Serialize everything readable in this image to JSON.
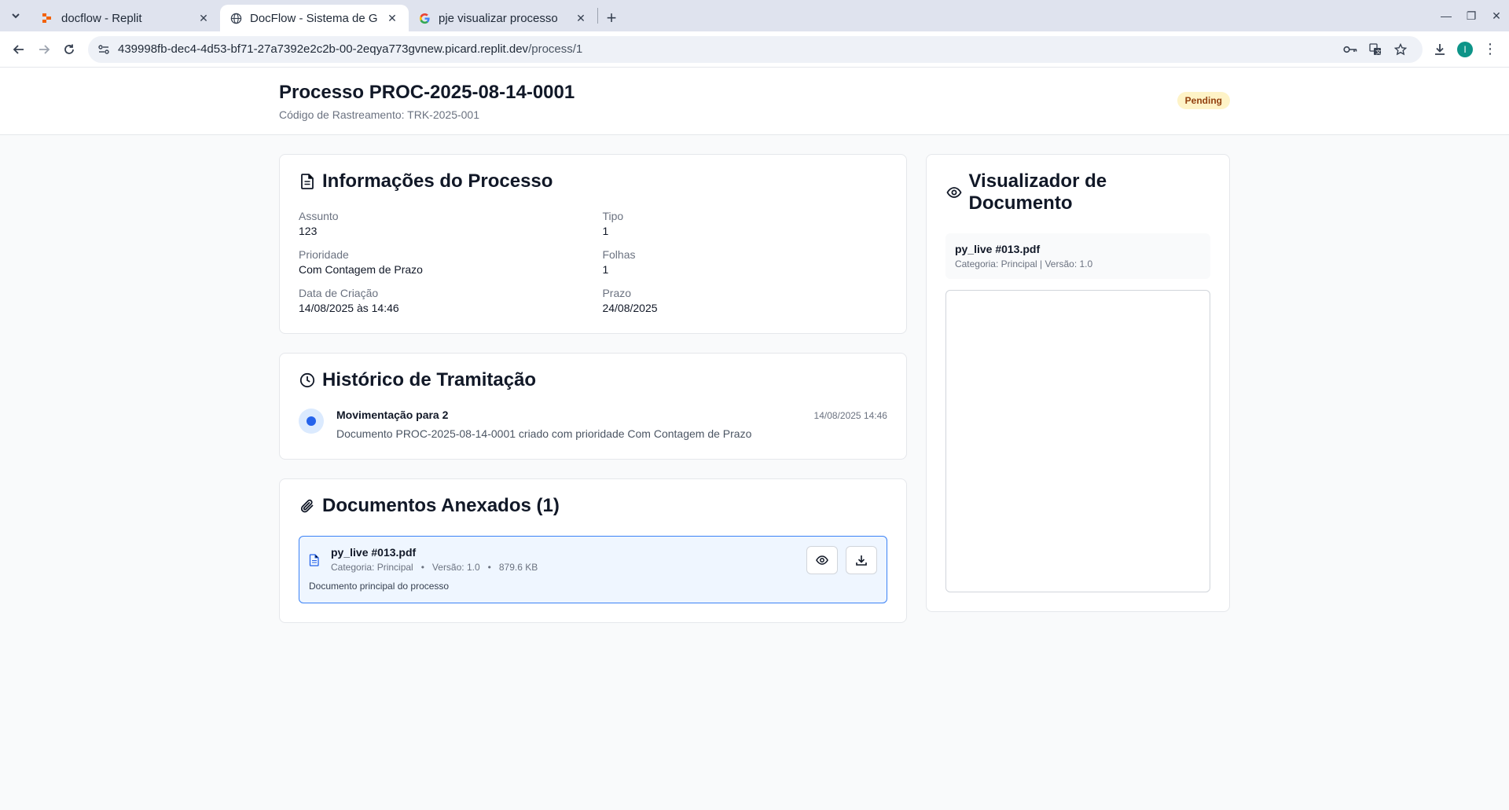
{
  "browser": {
    "tabs": [
      {
        "title": "docflow - Replit",
        "active": false
      },
      {
        "title": "DocFlow - Sistema de G",
        "active": true
      },
      {
        "title": "pje visualizar processo",
        "active": false
      }
    ],
    "url_host": "439998fb-dec4-4d53-bf71-27a7392e2c2b-00-2eqya773gvnew.picard.replit.dev",
    "url_path": "/process/1",
    "profile_initial": "I"
  },
  "header": {
    "title": "Processo PROC-2025-08-14-0001",
    "tracking": "Código de Rastreamento: TRK-2025-001",
    "status": "Pending"
  },
  "info": {
    "title": "Informações do Processo",
    "fields": [
      {
        "label": "Assunto",
        "value": "123"
      },
      {
        "label": "Tipo",
        "value": "1"
      },
      {
        "label": "Prioridade",
        "value": "Com Contagem de Prazo"
      },
      {
        "label": "Folhas",
        "value": "1"
      },
      {
        "label": "Data de Criação",
        "value": "14/08/2025 às 14:46"
      },
      {
        "label": "Prazo",
        "value": "24/08/2025"
      }
    ]
  },
  "history": {
    "title": "Histórico de Tramitação",
    "items": [
      {
        "title": "Movimentação para 2",
        "description": "Documento PROC-2025-08-14-0001 criado com prioridade Com Contagem de Prazo",
        "time": "14/08/2025 14:46"
      }
    ]
  },
  "attachments": {
    "title": "Documentos Anexados (1)",
    "items": [
      {
        "name": "py_live #013.pdf",
        "category": "Categoria: Principal",
        "version": "Versão: 1.0",
        "size": "879.6 KB",
        "description": "Documento principal do processo"
      }
    ]
  },
  "viewer": {
    "title": "Visualizador de Documento",
    "file_name": "py_live #013.pdf",
    "file_meta": "Categoria: Principal | Versão: 1.0"
  },
  "colors": {
    "accent": "#2563eb",
    "badge_bg": "#fef3c7",
    "badge_text": "#92400e"
  }
}
